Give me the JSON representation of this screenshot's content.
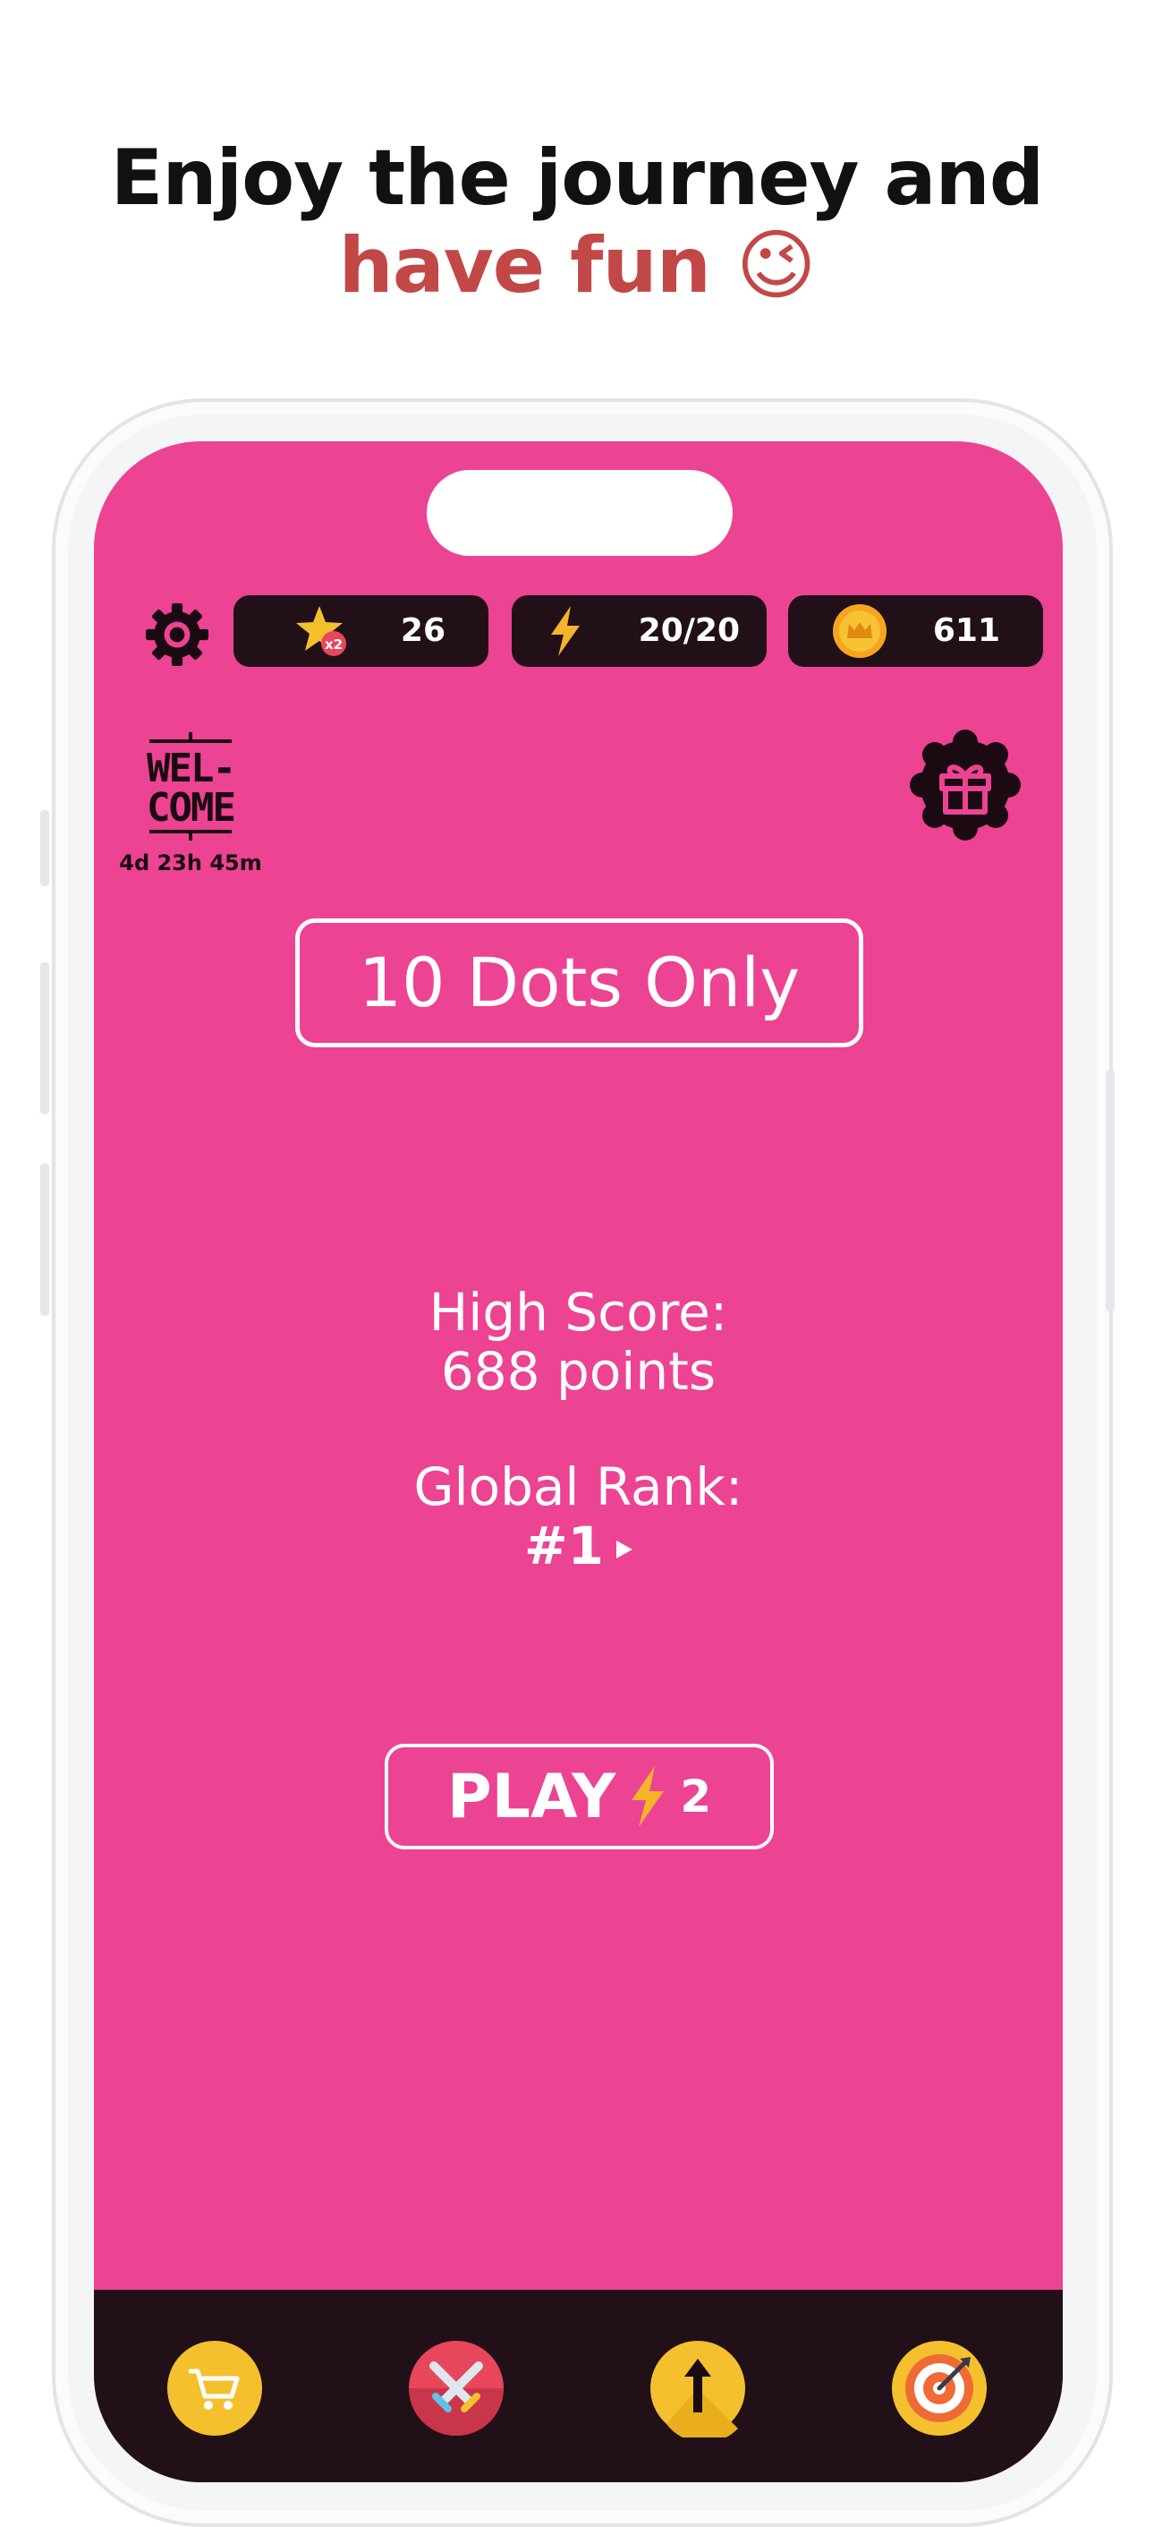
{
  "headline": {
    "line1": "Enjoy the journey and",
    "line2": "have fun",
    "emoji": "😉"
  },
  "status_bar": {
    "stars": {
      "icon": "star-x2-icon",
      "multiplier": "x2",
      "value": "26"
    },
    "energy": {
      "icon": "lightning-icon",
      "value": "20/20"
    },
    "coins": {
      "icon": "crown-coin-icon",
      "value": "611"
    }
  },
  "welcome": {
    "line1": "WEL-",
    "line2": "COME",
    "timer": "4d 23h 45m"
  },
  "mode_title": "10 Dots Only",
  "stats": {
    "high_score_label": "High Score:",
    "high_score_value": "688 points",
    "rank_label": "Global Rank:",
    "rank_value": "#1"
  },
  "play": {
    "label": "PLAY",
    "cost": "2"
  },
  "bottom_nav": [
    "shop-cart-icon",
    "battle-swords-icon",
    "upgrade-arrow-icon",
    "target-icon"
  ],
  "colors": {
    "screen_bg": "#ec4393",
    "dark": "#211018",
    "headline_accent": "#c24848",
    "gold": "#f5c02e"
  }
}
